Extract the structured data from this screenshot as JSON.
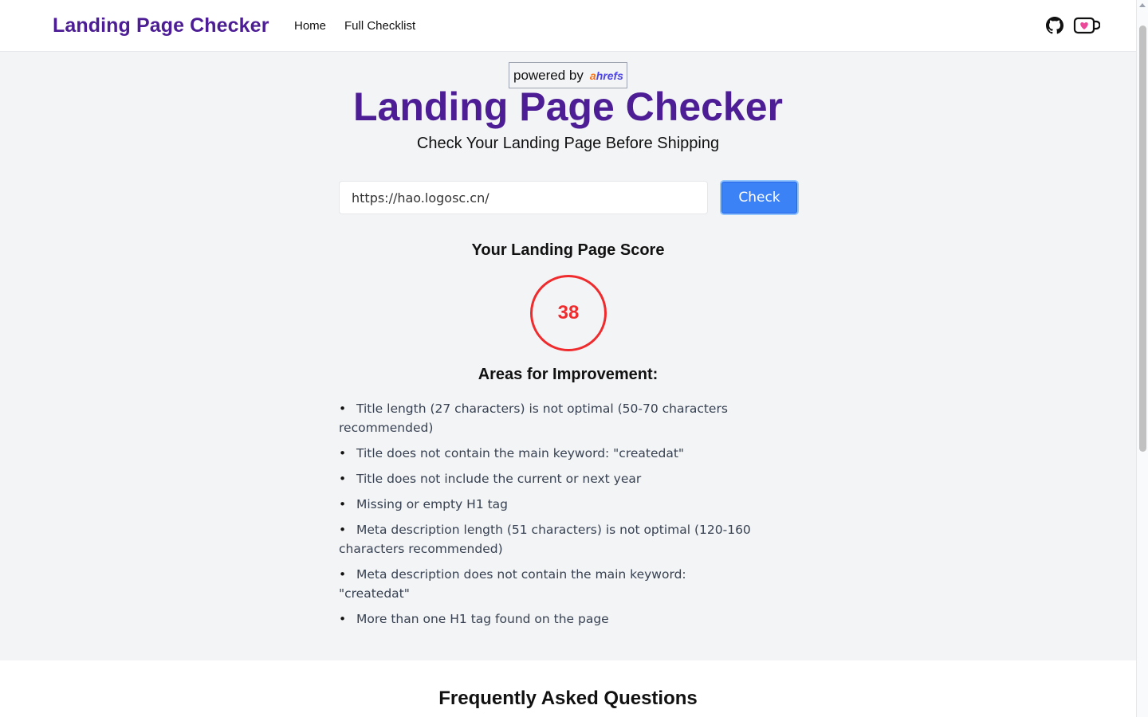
{
  "header": {
    "brand": "Landing Page Checker",
    "nav": [
      {
        "label": "Home"
      },
      {
        "label": "Full Checklist"
      }
    ],
    "icons": [
      "github-icon",
      "kofi-icon"
    ]
  },
  "hero": {
    "powered_by": "powered by",
    "powered_brand_a": "a",
    "powered_brand_rest": "hrefs",
    "title": "Landing Page Checker",
    "subtitle": "Check Your Landing Page Before Shipping"
  },
  "form": {
    "url_value": "https://hao.logosc.cn/",
    "button_label": "Check"
  },
  "score": {
    "title": "Your Landing Page Score",
    "value": "38",
    "color": "#ef2b2d"
  },
  "improvements": {
    "title": "Areas for Improvement:",
    "items": [
      "Title length (27 characters) is not optimal (50-70 characters recommended)",
      "Title does not contain the main keyword: \"createdat\"",
      "Title does not include the current or next year",
      "Missing or empty H1 tag",
      "Meta description length (51 characters) is not optimal (120-160 characters recommended)",
      "Meta description does not contain the main keyword: \"createdat\"",
      "More than one H1 tag found on the page"
    ]
  },
  "faq": {
    "title": "Frequently Asked Questions"
  },
  "colors": {
    "brand": "#4c1d95",
    "button": "#3b82f6",
    "background": "#f3f4f6"
  }
}
